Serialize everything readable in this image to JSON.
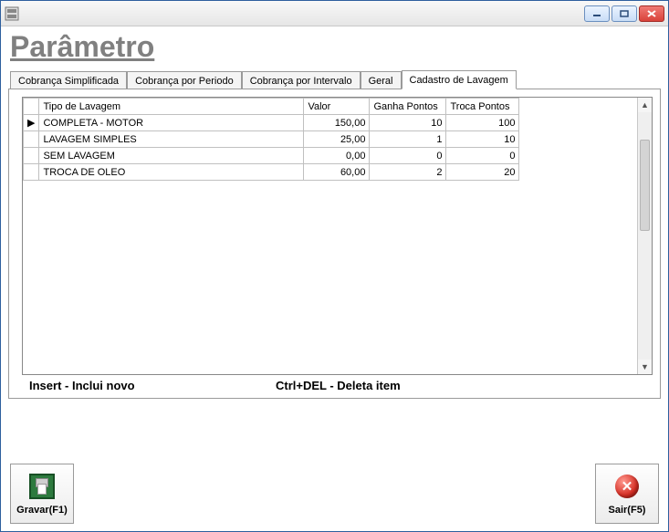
{
  "window": {
    "title": "Parâmetro"
  },
  "tabs": [
    {
      "label": "Cobrança Simplificada"
    },
    {
      "label": "Cobrança por Periodo"
    },
    {
      "label": "Cobrança por Intervalo"
    },
    {
      "label": "Geral"
    },
    {
      "label": "Cadastro de Lavagem"
    }
  ],
  "active_tab_index": 4,
  "grid": {
    "columns": {
      "tipo": "Tipo de Lavagem",
      "valor": "Valor",
      "ganha": "Ganha Pontos",
      "troca": "Troca Pontos"
    },
    "rows": [
      {
        "tipo": "COMPLETA - MOTOR",
        "valor": "150,00",
        "ganha": "10",
        "troca": "100"
      },
      {
        "tipo": "LAVAGEM SIMPLES",
        "valor": "25,00",
        "ganha": "1",
        "troca": "10"
      },
      {
        "tipo": "SEM LAVAGEM",
        "valor": "0,00",
        "ganha": "0",
        "troca": "0"
      },
      {
        "tipo": "TROCA DE OLEO",
        "valor": "60,00",
        "ganha": "2",
        "troca": "20"
      }
    ],
    "current_row_index": 0
  },
  "hints": {
    "insert": "Insert - Inclui novo",
    "delete": "Ctrl+DEL - Deleta item"
  },
  "toolbar": {
    "save_label": "Gravar(F1)",
    "exit_label": "Sair(F5)"
  }
}
